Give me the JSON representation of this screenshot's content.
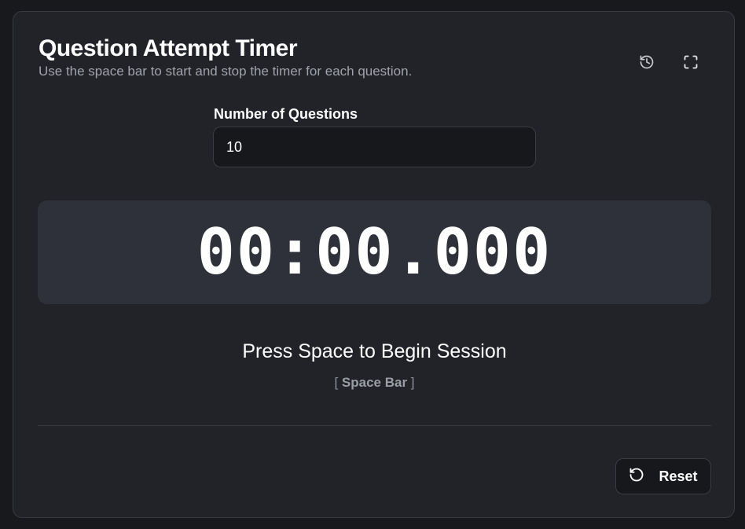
{
  "header": {
    "title": "Question Attempt Timer",
    "subtitle": "Use the space bar to start and stop the timer for each question.",
    "history_icon": "history-icon",
    "fullscreen_icon": "fullscreen-icon"
  },
  "settings": {
    "questions_label": "Number of Questions",
    "questions_value": "10"
  },
  "timer": {
    "display": "00:00.000"
  },
  "status": {
    "prompt": "Press Space to Begin Session",
    "hint_open": "[ ",
    "hint_key": "Space Bar",
    "hint_close": " ]"
  },
  "footer": {
    "reset_label": "Reset",
    "reset_icon": "reset-icon"
  },
  "colors": {
    "background": "#18191d",
    "card": "#212329",
    "timer_panel": "#2e3139",
    "text": "#ffffff",
    "muted_text": "#a0a3ab"
  }
}
